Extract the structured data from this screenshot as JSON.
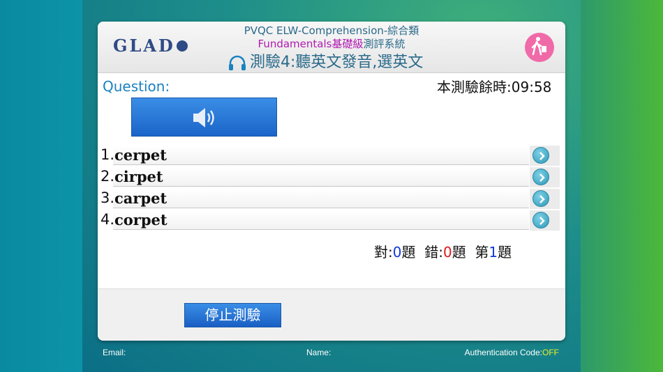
{
  "header": {
    "logo_text": "GLAD",
    "title_line1": "PVQC ELW-Comprehension-綜合類",
    "title_line2_part1": "Fundamentals基礎級",
    "title_line2_part2": "測評系統",
    "title_line3": "測驗4:聽英文發音,選英文"
  },
  "question": {
    "label": "Question:",
    "timer_label": "本測驗餘時:",
    "timer_value": "09:58"
  },
  "options": [
    {
      "num": "1.",
      "text": "cerpet"
    },
    {
      "num": "2.",
      "text": "cirpet"
    },
    {
      "num": "3.",
      "text": "carpet"
    },
    {
      "num": "4.",
      "text": "corpet"
    }
  ],
  "score": {
    "correct_label": "對:",
    "correct_value": "0",
    "correct_unit": "題",
    "wrong_label": "錯:",
    "wrong_value": "0",
    "wrong_unit": "題",
    "current_label": "第",
    "current_value": "1",
    "current_unit": "題"
  },
  "stop_button_label": "停止測驗",
  "footer": {
    "email_label": "Email:",
    "name_label": "Name:",
    "auth_label": "Authentication Code:",
    "auth_value": "OFF"
  },
  "colors": {
    "accent_blue": "#1a64c8",
    "title_teal": "#2a6a8a",
    "magenta": "#b01ab0",
    "correct_blue": "#1038d8",
    "wrong_red": "#e01818",
    "auth_yellow": "#f0f020"
  }
}
